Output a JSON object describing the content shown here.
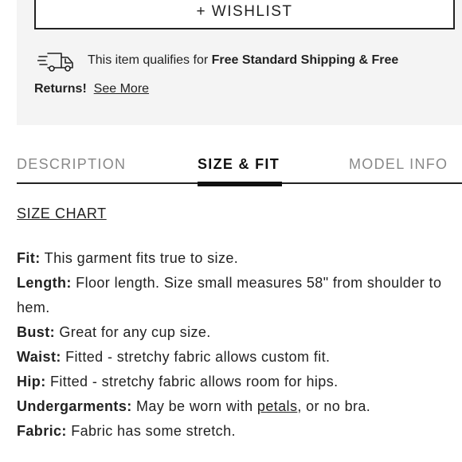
{
  "wishlist": {
    "label": "+ WISHLIST"
  },
  "shipping": {
    "icon": "delivery-truck-icon",
    "prefix": "This item qualifies for ",
    "bold_line1": "Free Standard Shipping & Free",
    "bold_line2": "Returns!",
    "see_more": "See More"
  },
  "tabs": [
    {
      "label": "DESCRIPTION",
      "active": false
    },
    {
      "label": "SIZE & FIT",
      "active": true
    },
    {
      "label": "MODEL INFO",
      "active": false
    }
  ],
  "size_chart": {
    "label": "SIZE CHART"
  },
  "specs": {
    "fit": {
      "key": "Fit:",
      "value": " This garment fits true to size."
    },
    "length": {
      "key": "Length:",
      "value": " Floor length. Size small measures 58\" from shoulder to hem."
    },
    "bust": {
      "key": "Bust:",
      "value": " Great for any cup size."
    },
    "waist": {
      "key": "Waist:",
      "value": " Fitted - stretchy fabric allows custom fit."
    },
    "hip": {
      "key": "Hip:",
      "value": " Fitted - stretchy fabric allows room for hips."
    },
    "undergarments": {
      "key": "Undergarments:",
      "before": " May be worn with ",
      "link": "petals",
      "after": ", or no bra."
    },
    "fabric": {
      "key": "Fabric:",
      "value": " Fabric has some stretch."
    }
  },
  "colors": {
    "text": "#222222",
    "panel": "#f4f4f4",
    "inactive_tab": "#888888"
  }
}
